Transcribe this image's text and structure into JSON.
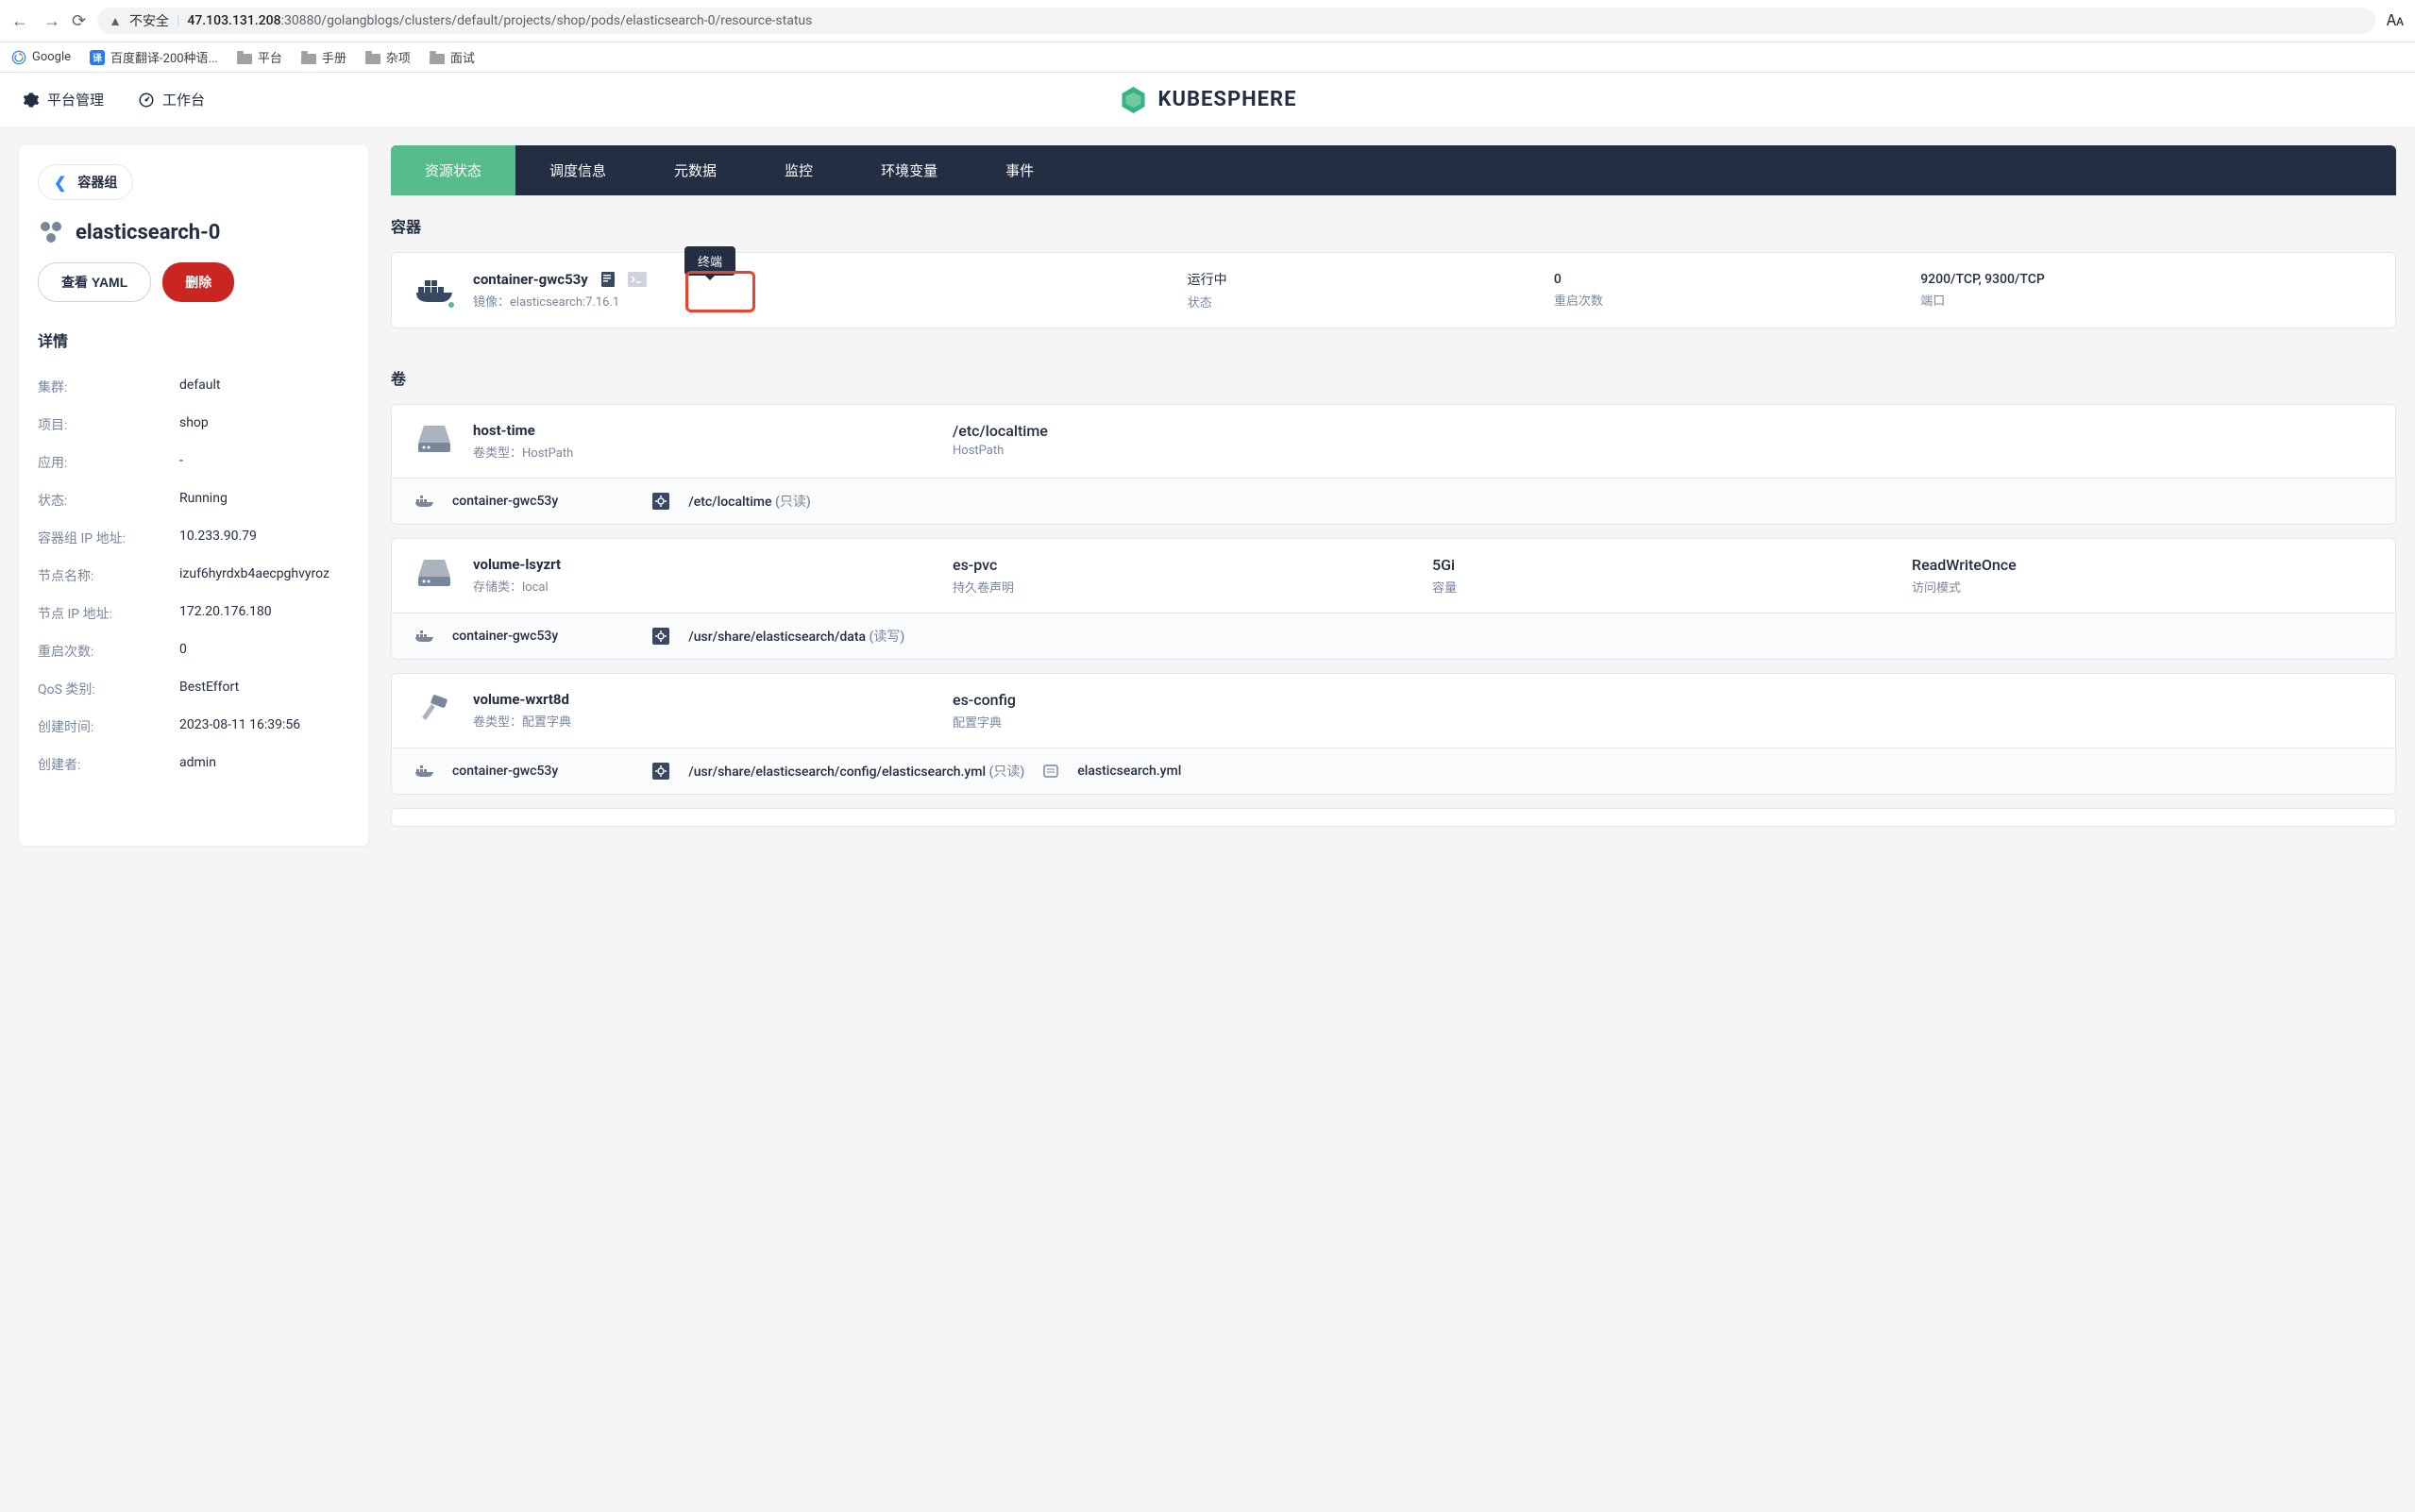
{
  "browser": {
    "url_prefix": "不安全",
    "url_host": "47.103.131.208",
    "url_path": ":30880/golangblogs/clusters/default/projects/shop/pods/elasticsearch-0/resource-status"
  },
  "bookmarks": {
    "google": "Google",
    "baidu": "百度翻译-200种语...",
    "platform": "平台",
    "manual": "手册",
    "misc": "杂项",
    "interview": "面试"
  },
  "header": {
    "platform_mgmt": "平台管理",
    "workbench": "工作台",
    "brand": "KUBESPHERE"
  },
  "sidebar": {
    "breadcrumb": "容器组",
    "pod_name": "elasticsearch-0",
    "btn_yaml": "查看 YAML",
    "btn_delete": "删除",
    "details_title": "详情",
    "rows": [
      {
        "label": "集群:",
        "value": "default"
      },
      {
        "label": "项目:",
        "value": "shop"
      },
      {
        "label": "应用:",
        "value": "-"
      },
      {
        "label": "状态:",
        "value": "Running"
      },
      {
        "label": "容器组 IP 地址:",
        "value": "10.233.90.79"
      },
      {
        "label": "节点名称:",
        "value": "izuf6hyrdxb4aecpghvyroz"
      },
      {
        "label": "节点 IP 地址:",
        "value": "172.20.176.180"
      },
      {
        "label": "重启次数:",
        "value": "0"
      },
      {
        "label": "QoS 类别:",
        "value": "BestEffort"
      },
      {
        "label": "创建时间:",
        "value": "2023-08-11 16:39:56"
      },
      {
        "label": "创建者:",
        "value": "admin"
      }
    ]
  },
  "tabs": {
    "resource_status": "资源状态",
    "schedule": "调度信息",
    "metadata": "元数据",
    "monitor": "监控",
    "env": "环境变量",
    "events": "事件"
  },
  "containers": {
    "title": "容器",
    "tooltip": "终端",
    "name": "container-gwc53y",
    "image_label": "镜像：",
    "image_value": "elasticsearch:7.16.1",
    "status_value": "运行中",
    "status_label": "状态",
    "restart_value": "0",
    "restart_label": "重启次数",
    "ports_value": "9200/TCP, 9300/TCP",
    "ports_label": "端口"
  },
  "volumes": {
    "title": "卷",
    "items": [
      {
        "name": "host-time",
        "type_label": "卷类型：",
        "type_value": "HostPath",
        "col2_value": "/etc/localtime",
        "col2_label": "HostPath",
        "mount_container": "container-gwc53y",
        "mount_path": "/etc/localtime",
        "mount_mode": "(只读)"
      },
      {
        "name": "volume-lsyzrt",
        "type_label": "存储类：",
        "type_value": "local",
        "col2_value": "es-pvc",
        "col2_label": "持久卷声明",
        "col3_value": "5Gi",
        "col3_label": "容量",
        "col4_value": "ReadWriteOnce",
        "col4_label": "访问模式",
        "mount_container": "container-gwc53y",
        "mount_path": "/usr/share/elasticsearch/data",
        "mount_mode": "(读写)"
      },
      {
        "name": "volume-wxrt8d",
        "type_label": "卷类型：",
        "type_value": "配置字典",
        "col2_value": "es-config",
        "col2_label": "配置字典",
        "mount_container": "container-gwc53y",
        "mount_path": "/usr/share/elasticsearch/config/elasticsearch.yml",
        "mount_mode": "(只读)",
        "mount_file": "elasticsearch.yml"
      }
    ]
  }
}
